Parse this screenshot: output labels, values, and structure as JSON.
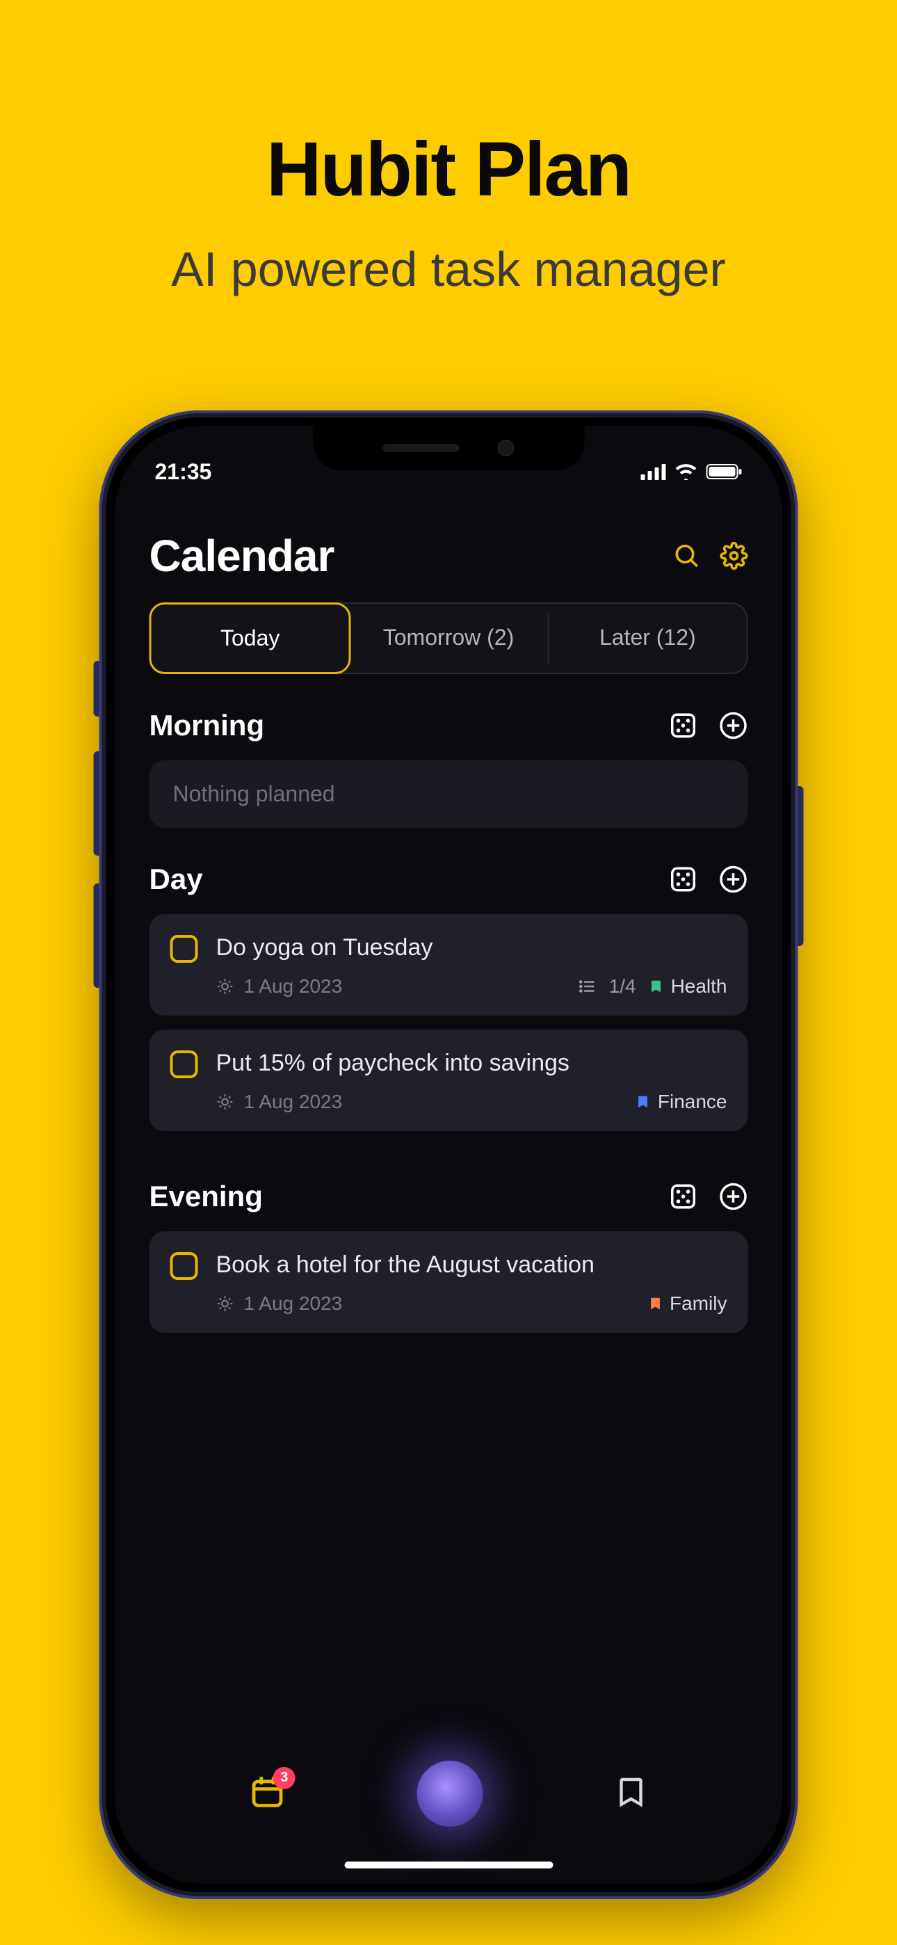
{
  "promo": {
    "title": "Hubit Plan",
    "subtitle": "AI powered task manager"
  },
  "status": {
    "time": "21:35"
  },
  "header": {
    "title": "Calendar"
  },
  "tabs": {
    "today": "Today",
    "tomorrow": "Tomorrow  (2)",
    "later": "Later (12)"
  },
  "sections": {
    "morning": {
      "title": "Morning",
      "empty": "Nothing planned"
    },
    "day": {
      "title": "Day",
      "tasks": [
        {
          "title": "Do yoga on Tuesday",
          "date": "1 Aug 2023",
          "subtasks": "1/4",
          "tag": "Health",
          "tag_color": "#3BC489"
        },
        {
          "title": "Put 15% of paycheck into savings",
          "date": "1 Aug 2023",
          "tag": "Finance",
          "tag_color": "#4A7BFF"
        }
      ]
    },
    "evening": {
      "title": "Evening",
      "tasks": [
        {
          "title": "Book a hotel for the August vacation",
          "date": "1 Aug 2023",
          "tag": "Family",
          "tag_color": "#FF7A45"
        }
      ]
    }
  },
  "nav": {
    "badge": "3"
  }
}
